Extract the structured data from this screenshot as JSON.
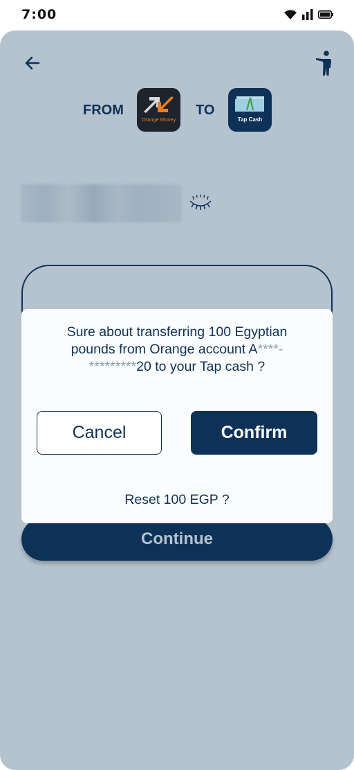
{
  "status_bar": {
    "time": "7:00",
    "icons": [
      "wifi-icon",
      "signal-icon",
      "battery-icon"
    ]
  },
  "header": {
    "back_icon": "arrow-left-icon",
    "accessibility_icon": "accessibility-person-icon"
  },
  "transfer": {
    "from_label": "FROM",
    "to_label": "TO",
    "source_logo_text": "Orange Money",
    "destination_logo_text": "Tap Cash"
  },
  "account": {
    "visibility_icon": "eye-closed-icon"
  },
  "dialog": {
    "message_part1": "Sure about transferring 100 Egyptian pounds from Orange account A",
    "message_mask1": "****-*********",
    "message_part2": "20 to your Tap cash ?",
    "cancel_label": "Cancel",
    "confirm_label": "Confirm",
    "reset_label": "Reset 100 EGP ?"
  },
  "footer": {
    "continue_label": "Continue"
  },
  "colors": {
    "primary": "#0e3157",
    "background": "#b5c3cf",
    "dialog_bg": "#fbfcfd",
    "orange_brand": "#ef7d1f"
  }
}
